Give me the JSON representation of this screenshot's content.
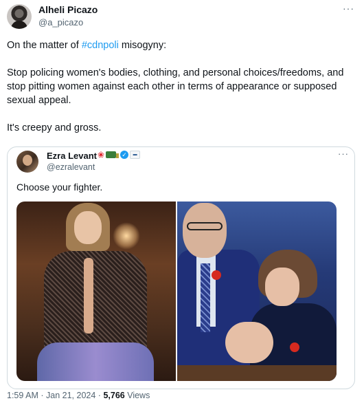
{
  "tweet": {
    "author_name": "Alheli Picazo",
    "author_handle": "@a_picazo",
    "more_icon": "more-horizontal-icon",
    "text": {
      "line1_prefix": "On the matter of ",
      "hashtag": "#cdnpoli",
      "line1_suffix": " misogyny:",
      "paragraph2": "Stop policing women's bodies, clothing, and personal choices/freedoms, and stop pitting women against each other in terms of appearance or supposed sexual appeal.",
      "paragraph3": "It's creepy and gross."
    },
    "accent_color": "#1d9bf0"
  },
  "quoted": {
    "author_name": "Ezra Levant",
    "author_handle": "@ezralevant",
    "badges": [
      "maple-leaf-icon",
      "truck-icon",
      "verified-badge-icon",
      "affiliation-badge-icon"
    ],
    "text": "Choose your fighter.",
    "images": [
      "photo-woman-sheer-dress",
      "photo-parliament-man-and-woman"
    ]
  },
  "meta": {
    "time": "1:59 AM",
    "separator": "·",
    "date": "Jan 21, 2024",
    "views_count": "5,766",
    "views_label": "Views"
  }
}
